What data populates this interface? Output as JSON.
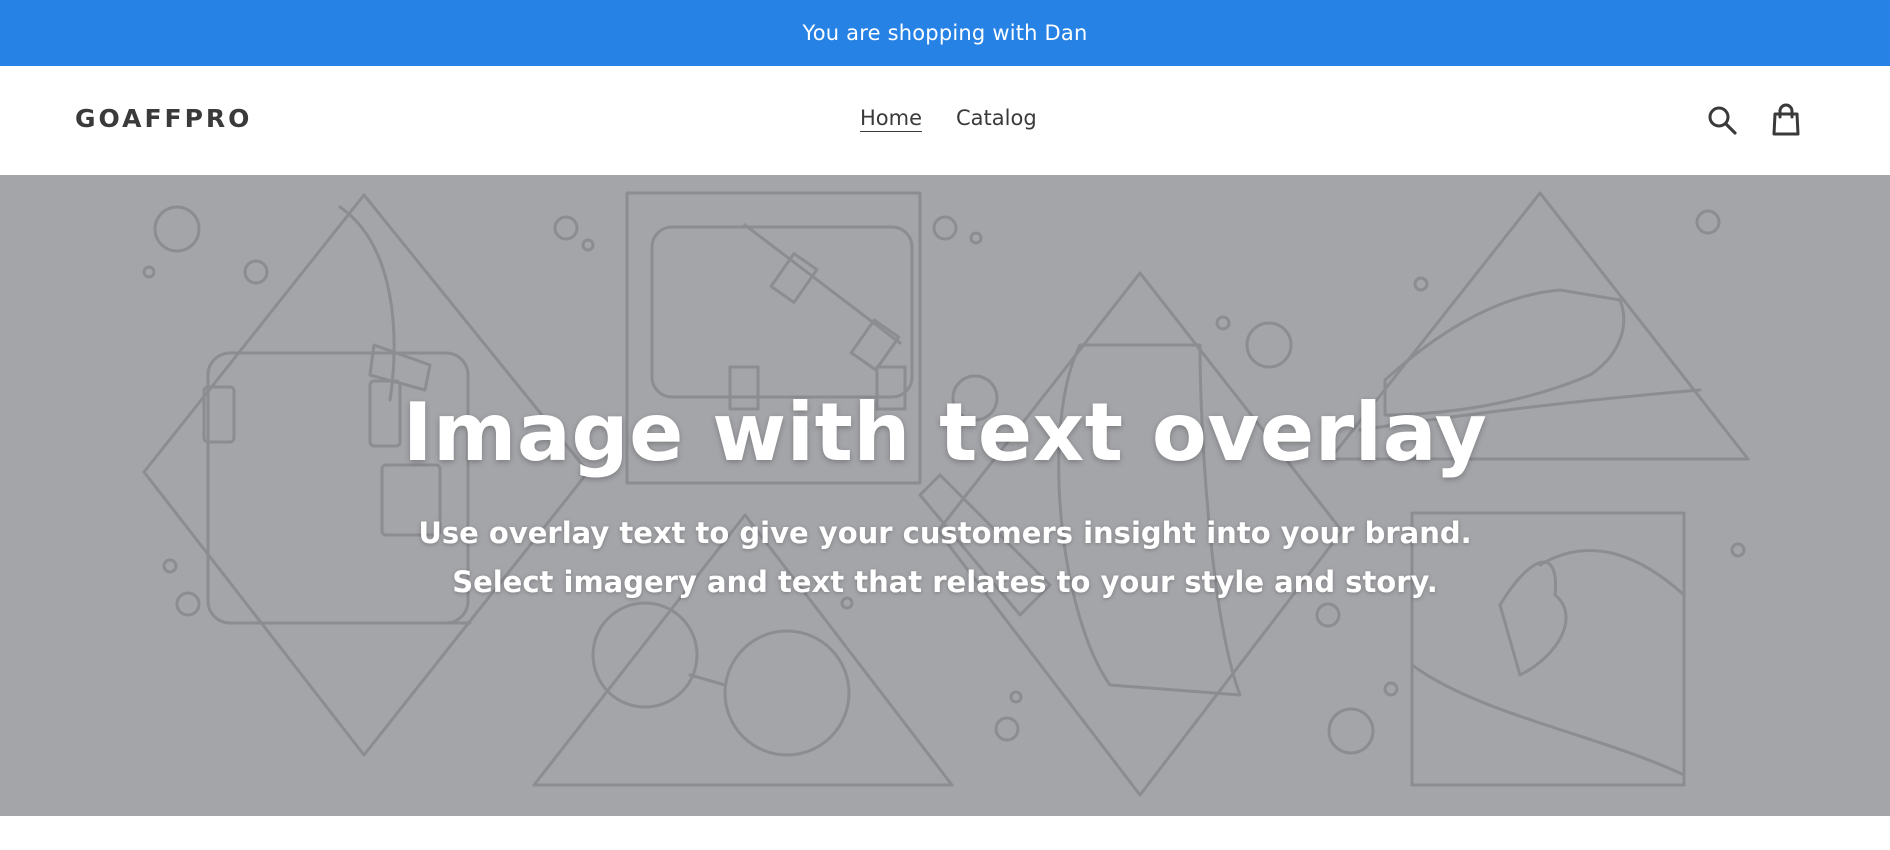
{
  "announcement": {
    "text": "You are shopping with Dan",
    "bg_color": "#2782e5"
  },
  "header": {
    "logo": "GOAFFPRO",
    "nav": [
      {
        "label": "Home",
        "active": true
      },
      {
        "label": "Catalog",
        "active": false
      }
    ],
    "icons": [
      "search-icon",
      "cart-icon"
    ]
  },
  "hero": {
    "title": "Image with text overlay",
    "subtitle_line1": "Use overlay text to give your customers insight into your brand.",
    "subtitle_line2": "Select imagery and text that relates to your style and story.",
    "bg_color": "#a4a5a9"
  }
}
